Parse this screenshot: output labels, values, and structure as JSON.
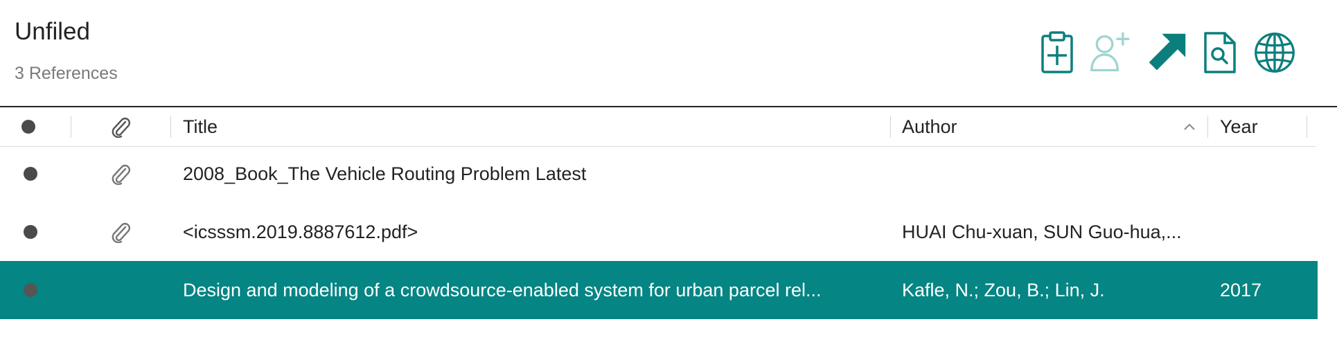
{
  "header": {
    "title": "Unfiled",
    "subtitle": "3 References",
    "toolbar": [
      {
        "icon": "clipboard-add-icon",
        "color": "#0b7f7d"
      },
      {
        "icon": "add-person-icon",
        "color": "#9fd3d1"
      },
      {
        "icon": "open-arrow-icon",
        "color": "#0b7f7d"
      },
      {
        "icon": "document-search-icon",
        "color": "#0b7f7d"
      },
      {
        "icon": "globe-icon",
        "color": "#0b7f7d"
      }
    ]
  },
  "columns": {
    "read": "",
    "attachment": "",
    "title": "Title",
    "author": "Author",
    "year": "Year"
  },
  "rows": [
    {
      "title": "2008_Book_The Vehicle Routing Problem Latest",
      "author": "",
      "year": "",
      "has_attachment": true,
      "selected": false
    },
    {
      "title": "<icsssm.2019.8887612.pdf>",
      "author": "HUAI Chu-xuan, SUN Guo-hua,...",
      "year": "",
      "has_attachment": true,
      "selected": false
    },
    {
      "title": "Design and modeling of a crowdsource-enabled system for urban parcel rel...",
      "author": "Kafle, N.; Zou, B.; Lin, J.",
      "year": "2017",
      "has_attachment": false,
      "selected": true
    }
  ],
  "colors": {
    "accent": "#058583",
    "icon_teal": "#0b7f7d",
    "icon_disabled": "#9fd3d1"
  }
}
